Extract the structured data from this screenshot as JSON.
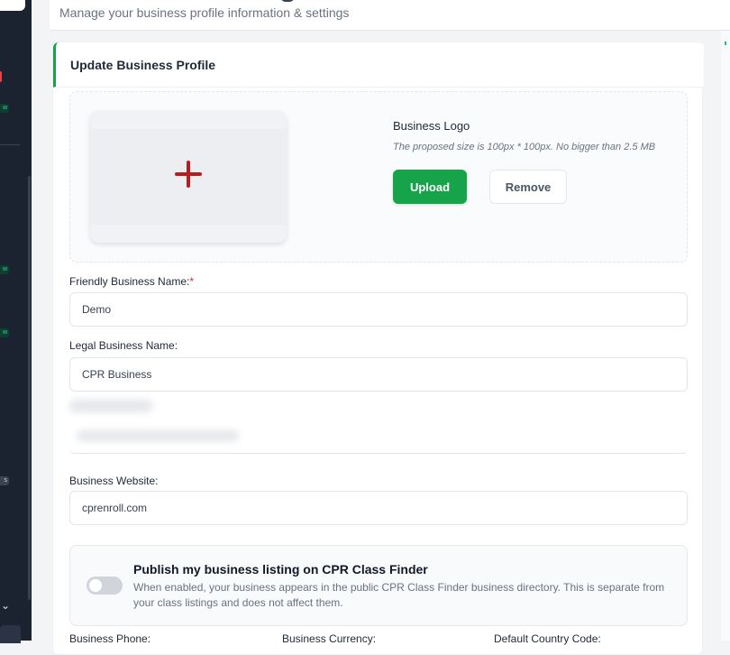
{
  "header": {
    "subtitle": "Manage your business profile information & settings"
  },
  "sidebar": {
    "badges": [
      "w",
      "w",
      "w",
      "w"
    ],
    "gray_badge": "s",
    "chevron": "⌄"
  },
  "card": {
    "title": "Update Business Profile",
    "logo": {
      "label": "Business Logo",
      "hint": "The proposed size is 100px * 100px. No bigger than 2.5 MB",
      "upload_label": "Upload",
      "remove_label": "Remove"
    },
    "fields": {
      "friendly_name_label": "Friendly Business Name:",
      "friendly_name_required": "*",
      "friendly_name_value": "Demo",
      "legal_name_label": "Legal Business Name:",
      "legal_name_value": "CPR Business",
      "website_label": "Business Website:",
      "website_value": "cprenroll.com"
    },
    "publish": {
      "title": "Publish my business listing on CPR Class Finder",
      "description": "When enabled, your business appears in the public CPR Class Finder business directory. This is separate from your class listings and does not affect them.",
      "enabled": false
    },
    "bottom_labels": [
      "Business Phone:",
      "Business Currency:",
      "Default Country Code:"
    ]
  },
  "colors": {
    "accent": "#16a34a",
    "required": "#dc2626",
    "plus_icon": "#b91c1c",
    "sidebar_bg": "#1b2330"
  }
}
